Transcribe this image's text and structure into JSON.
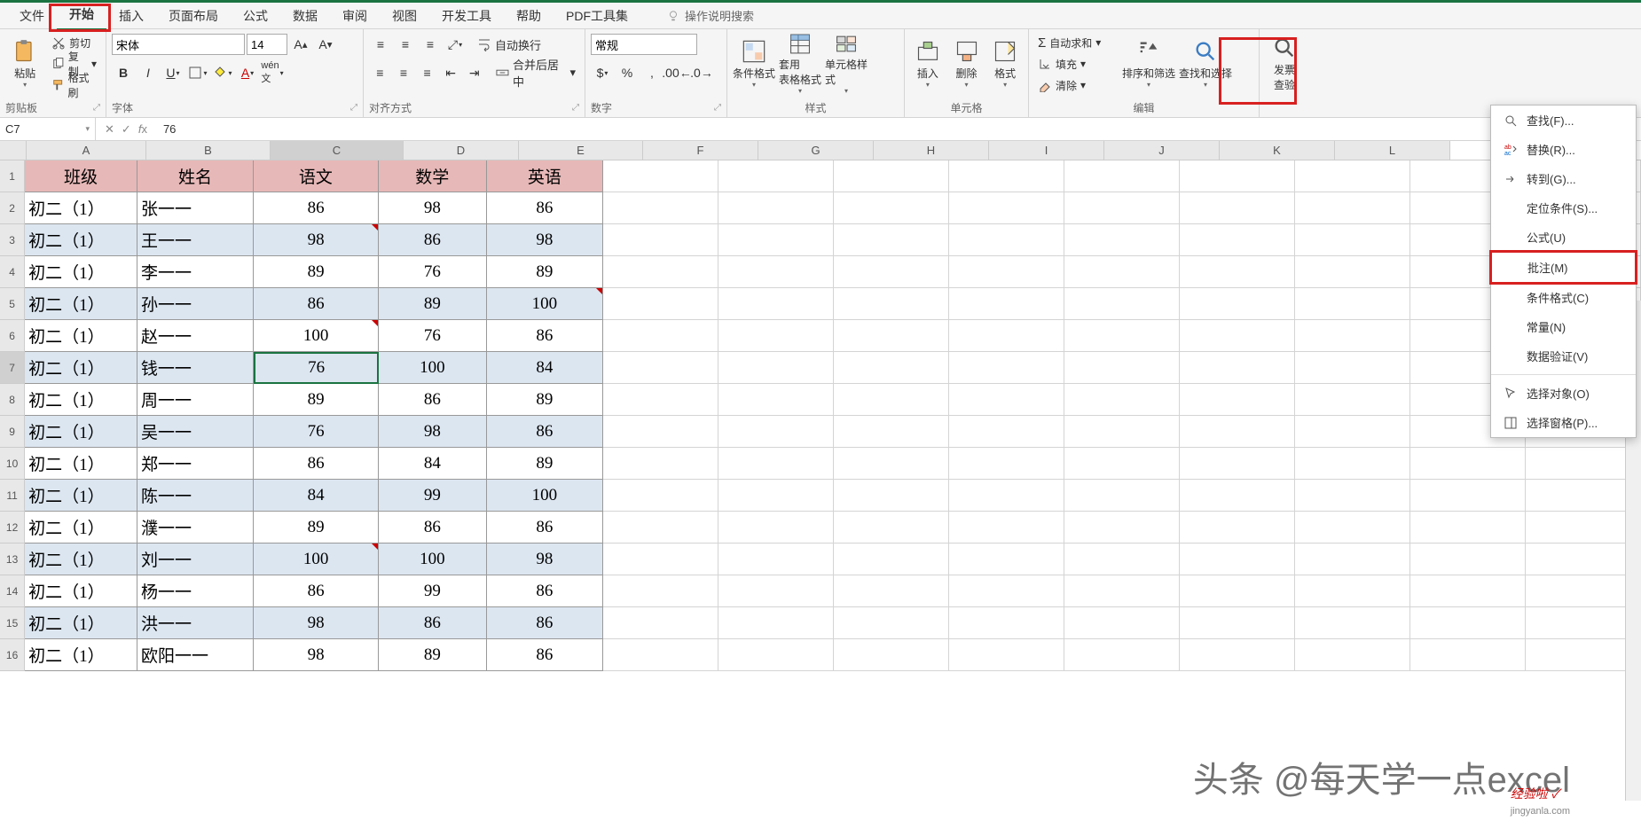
{
  "tabs": [
    "文件",
    "开始",
    "插入",
    "页面布局",
    "公式",
    "数据",
    "审阅",
    "视图",
    "开发工具",
    "帮助",
    "PDF工具集"
  ],
  "active_tab": 1,
  "tellme": "操作说明搜索",
  "ribbon": {
    "clipboard": {
      "paste": "粘贴",
      "cut": "剪切",
      "copy": "复制",
      "painter": "格式刷",
      "label": "剪贴板"
    },
    "font": {
      "name": "宋体",
      "size": "14",
      "label": "字体"
    },
    "align": {
      "wrap": "自动换行",
      "merge": "合并后居中",
      "label": "对齐方式"
    },
    "number": {
      "format": "常规",
      "label": "数字"
    },
    "styles": {
      "condfmt": "条件格式",
      "table": "套用\n表格格式",
      "cellstyle": "单元格样式",
      "label": "样式"
    },
    "cells": {
      "insert": "插入",
      "delete": "删除",
      "format": "格式",
      "label": "单元格"
    },
    "editing": {
      "autosum": "自动求和",
      "fill": "填充",
      "clear": "清除",
      "sort": "排序和筛选",
      "find": "查找和选择",
      "label": "编辑"
    },
    "invoice": "发票\n查验"
  },
  "namebox": "C7",
  "fx_value": "76",
  "columns": [
    "A",
    "B",
    "C",
    "D",
    "E",
    "F",
    "G",
    "H",
    "I",
    "J",
    "K",
    "L"
  ],
  "header_row": [
    "班级",
    "姓名",
    "语文",
    "数学",
    "英语"
  ],
  "data_rows": [
    {
      "n": 2,
      "c": [
        "初二（1）",
        "张一一",
        "86",
        "98",
        "86"
      ],
      "blue": false,
      "comments": []
    },
    {
      "n": 3,
      "c": [
        "初二（1）",
        "王一一",
        "98",
        "86",
        "98"
      ],
      "blue": true,
      "comments": [
        2
      ]
    },
    {
      "n": 4,
      "c": [
        "初二（1）",
        "李一一",
        "89",
        "76",
        "89"
      ],
      "blue": false,
      "comments": []
    },
    {
      "n": 5,
      "c": [
        "初二（1）",
        "孙一一",
        "86",
        "89",
        "100"
      ],
      "blue": true,
      "comments": [
        4
      ]
    },
    {
      "n": 6,
      "c": [
        "初二（1）",
        "赵一一",
        "100",
        "76",
        "86"
      ],
      "blue": false,
      "comments": [
        2
      ]
    },
    {
      "n": 7,
      "c": [
        "初二（1）",
        "钱一一",
        "76",
        "100",
        "84"
      ],
      "blue": true,
      "comments": []
    },
    {
      "n": 8,
      "c": [
        "初二（1）",
        "周一一",
        "89",
        "86",
        "89"
      ],
      "blue": false,
      "comments": []
    },
    {
      "n": 9,
      "c": [
        "初二（1）",
        "吴一一",
        "76",
        "98",
        "86"
      ],
      "blue": true,
      "comments": []
    },
    {
      "n": 10,
      "c": [
        "初二（1）",
        "郑一一",
        "86",
        "84",
        "89"
      ],
      "blue": false,
      "comments": []
    },
    {
      "n": 11,
      "c": [
        "初二（1）",
        "陈一一",
        "84",
        "99",
        "100"
      ],
      "blue": true,
      "comments": []
    },
    {
      "n": 12,
      "c": [
        "初二（1）",
        "濮一一",
        "89",
        "86",
        "86"
      ],
      "blue": false,
      "comments": []
    },
    {
      "n": 13,
      "c": [
        "初二（1）",
        "刘一一",
        "100",
        "100",
        "98"
      ],
      "blue": true,
      "comments": [
        2
      ]
    },
    {
      "n": 14,
      "c": [
        "初二（1）",
        "杨一一",
        "86",
        "99",
        "86"
      ],
      "blue": false,
      "comments": []
    },
    {
      "n": 15,
      "c": [
        "初二（1）",
        "洪一一",
        "98",
        "86",
        "86"
      ],
      "blue": true,
      "comments": []
    },
    {
      "n": 16,
      "c": [
        "初二（1）",
        "欧阳一一",
        "98",
        "89",
        "86"
      ],
      "blue": false,
      "comments": []
    }
  ],
  "active_cell": {
    "row": 7,
    "col": 2
  },
  "dropdown": {
    "items": [
      {
        "icon": "search",
        "label": "查找(F)..."
      },
      {
        "icon": "replace",
        "label": "替换(R)..."
      },
      {
        "icon": "goto",
        "label": "转到(G)..."
      },
      {
        "icon": "",
        "label": "定位条件(S)..."
      },
      {
        "icon": "",
        "label": "公式(U)"
      },
      {
        "icon": "",
        "label": "批注(M)",
        "hl": true
      },
      {
        "icon": "",
        "label": "条件格式(C)"
      },
      {
        "icon": "",
        "label": "常量(N)"
      },
      {
        "icon": "",
        "label": "数据验证(V)"
      },
      {
        "icon": "pointer",
        "label": "选择对象(O)"
      },
      {
        "icon": "pane",
        "label": "选择窗格(P)..."
      }
    ]
  },
  "watermark": "头条 @每天学一点excel",
  "watermark2": "经验啦 ✓",
  "watermark3": "jingyanla.com"
}
